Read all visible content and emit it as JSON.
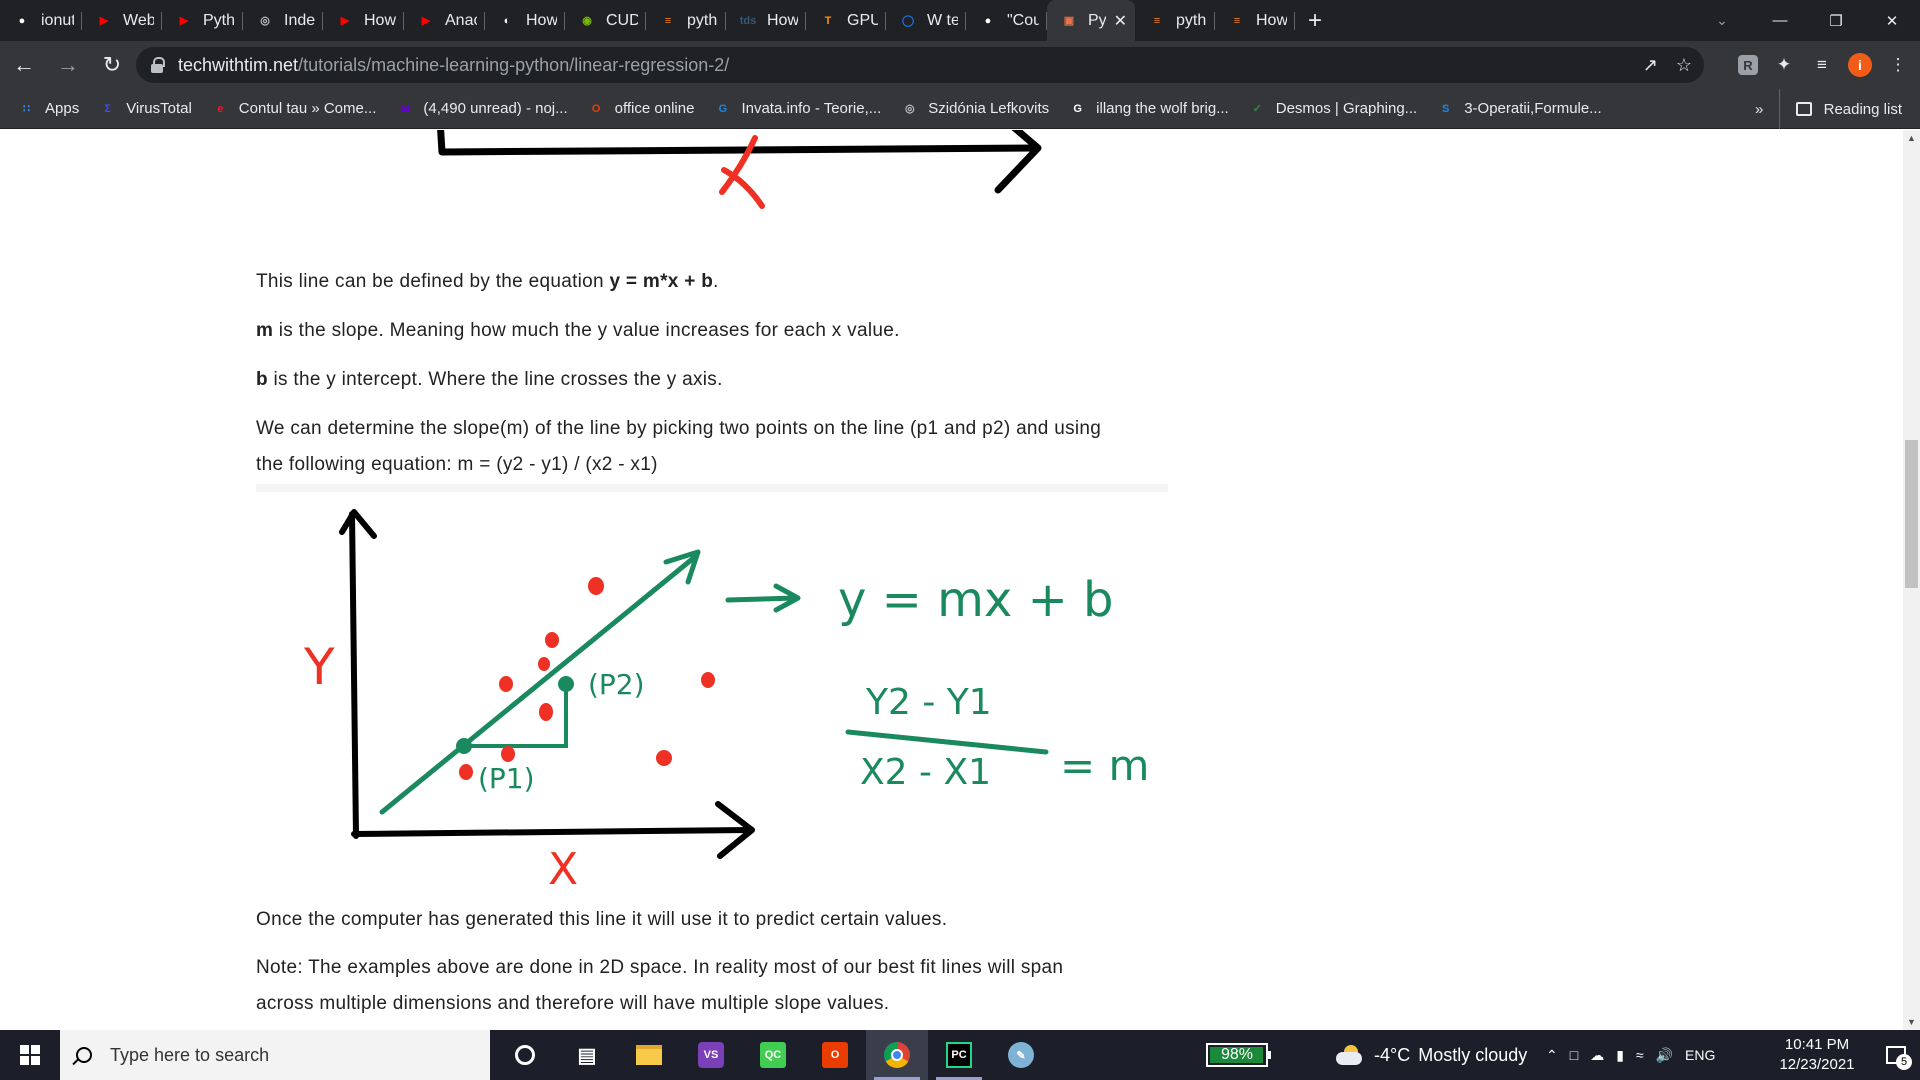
{
  "browser": {
    "tabs": [
      {
        "title": "ionutn",
        "icon": "github-icon",
        "color": "#ffffff"
      },
      {
        "title": "Web Sc",
        "icon": "youtube-icon",
        "color": "#ff0000"
      },
      {
        "title": "Python",
        "icon": "youtube-icon",
        "color": "#ff0000"
      },
      {
        "title": "Index o",
        "icon": "globe-icon",
        "color": "#bdc1c6"
      },
      {
        "title": "How to",
        "icon": "youtube-icon",
        "color": "#ff0000"
      },
      {
        "title": "Anacon",
        "icon": "youtube-icon",
        "color": "#ff0000"
      },
      {
        "title": "How to",
        "icon": "codemy-icon",
        "color": "#ffffff"
      },
      {
        "title": "CUDA T",
        "icon": "nvidia-icon",
        "color": "#76b900"
      },
      {
        "title": "python",
        "icon": "stackoverflow-icon",
        "color": "#f48024"
      },
      {
        "title": "How to",
        "icon": "tds-icon",
        "color": "#355876"
      },
      {
        "title": "GPU su",
        "icon": "tensorflow-icon",
        "color": "#ff8f00"
      },
      {
        "title": "W tens",
        "icon": "circle-icon",
        "color": "#1a73e8"
      },
      {
        "title": "\"Could",
        "icon": "github-icon",
        "color": "#ffffff"
      },
      {
        "title": "Pyt",
        "icon": "techwithtim-icon",
        "color": "#e9734a",
        "active": true
      },
      {
        "title": "python",
        "icon": "stackoverflow-icon",
        "color": "#f48024"
      },
      {
        "title": "How to",
        "icon": "stackoverflow-icon",
        "color": "#f48024"
      }
    ],
    "new_tab_label": "+",
    "url_domain": "techwithtim.net",
    "url_path": "/tutorials/machine-learning-python/linear-regression-2/",
    "bookmarks": [
      {
        "label": "Apps",
        "icon": "apps-grid-icon",
        "color": "#4285f4"
      },
      {
        "label": "VirusTotal",
        "icon": "virustotal-icon",
        "color": "#394eff"
      },
      {
        "label": "Contul tau » Come...",
        "icon": "emag-icon",
        "color": "#e3192d"
      },
      {
        "label": "(4,490 unread) - noj...",
        "icon": "yahoo-mail-icon",
        "color": "#6001d2"
      },
      {
        "label": "office online",
        "icon": "office-icon",
        "color": "#eb3c00"
      },
      {
        "label": "Invata.info - Teorie,...",
        "icon": "invata-icon",
        "color": "#1e88e5"
      },
      {
        "label": "Szidónia Lefkovits",
        "icon": "globe-icon",
        "color": "#bdc1c6"
      },
      {
        "label": "illang the wolf brig...",
        "icon": "google-icon",
        "color": "#ffffff"
      },
      {
        "label": "Desmos | Graphing...",
        "icon": "desmos-icon",
        "color": "#2f8c3f"
      },
      {
        "label": "3-Operatii,Formule...",
        "icon": "operatii-icon",
        "color": "#1e88e5"
      }
    ],
    "more_bookmarks": "»",
    "reading_list": "Reading list",
    "profile_initial": "i"
  },
  "article": {
    "p1_pre": "This line can be defined by the equation ",
    "p1_bold": "y = m*x + b",
    "p1_post": ".",
    "p2_bold": "m",
    "p2_post": " is the slope. Meaning how much the y value increases for each x value.",
    "p3_bold": "b",
    "p3_post": " is the y intercept. Where the line crosses the y axis.",
    "p4_line1": "We can determine the slope(m) of the line by picking two points on the line (p1 and p2) and using",
    "p4_line2": "the following equation: m = (y2 - y1) / (x2 - x1)",
    "p5": "Once the computer has generated this line it will use it to predict certain values.",
    "p6_line1": "Note: The examples above are done in 2D space. In reality most of our best fit lines will span",
    "p6_line2": "across multiple dimensions and therefore will have multiple slope values."
  },
  "figure": {
    "top_x_label": "X",
    "y_label": "Y",
    "x_label": "X",
    "p1_label": "(P1)",
    "p2_label": "(P2)",
    "equation": "y = mx + b",
    "numerator": "Y2 - Y1",
    "denominator": "X2 - X1",
    "equals_m": "= m",
    "ink_green": "#1a8a5e",
    "ink_red": "#ee3124"
  },
  "taskbar": {
    "search_placeholder": "Type here to search",
    "apps": [
      {
        "name": "cortana-icon"
      },
      {
        "name": "task-view-icon"
      },
      {
        "name": "file-explorer-icon"
      },
      {
        "name": "visual-studio-icon"
      },
      {
        "name": "qt-creator-icon"
      },
      {
        "name": "office-icon"
      },
      {
        "name": "chrome-icon"
      },
      {
        "name": "pycharm-icon"
      },
      {
        "name": "paint-icon"
      }
    ],
    "battery": "98%",
    "weather_temp": "-4°C",
    "weather_desc": "Mostly cloudy",
    "language": "ENG",
    "time": "10:41 PM",
    "date": "12/23/2021",
    "notifications": "5"
  }
}
